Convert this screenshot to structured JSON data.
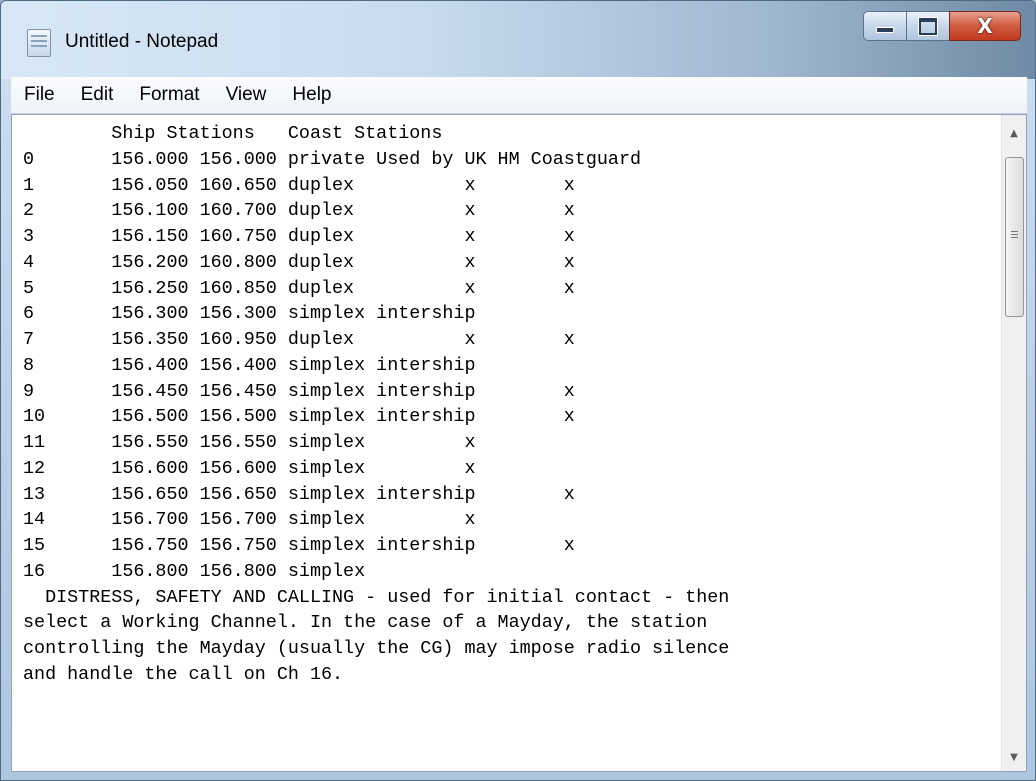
{
  "window": {
    "title": "Untitled - Notepad",
    "icons": {
      "app": "notepad-icon",
      "minimize": "minimize-icon",
      "maximize": "maximize-icon",
      "close": "close-icon"
    },
    "close_glyph": "X"
  },
  "menu": [
    "File",
    "Edit",
    "Format",
    "View",
    "Help"
  ],
  "editor": {
    "lines": [
      "        Ship Stations   Coast Stations",
      "0       156.000 156.000 private Used by UK HM Coastguard",
      "1       156.050 160.650 duplex          x        x",
      "2       156.100 160.700 duplex          x        x",
      "3       156.150 160.750 duplex          x        x",
      "4       156.200 160.800 duplex          x        x",
      "5       156.250 160.850 duplex          x        x",
      "6       156.300 156.300 simplex intership",
      "7       156.350 160.950 duplex          x        x",
      "8       156.400 156.400 simplex intership",
      "9       156.450 156.450 simplex intership        x",
      "10      156.500 156.500 simplex intership        x",
      "11      156.550 156.550 simplex         x",
      "12      156.600 156.600 simplex         x",
      "13      156.650 156.650 simplex intership        x",
      "14      156.700 156.700 simplex         x",
      "15      156.750 156.750 simplex intership        x",
      "16      156.800 156.800 simplex",
      "  DISTRESS, SAFETY AND CALLING - used for initial contact - then",
      "select a Working Channel. In the case of a Mayday, the station",
      "controlling the Mayday (usually the CG) may impose radio silence",
      "and handle the call on Ch 16."
    ]
  },
  "scrollbar": {
    "up_arrow": "▲",
    "down_arrow": "▼"
  }
}
